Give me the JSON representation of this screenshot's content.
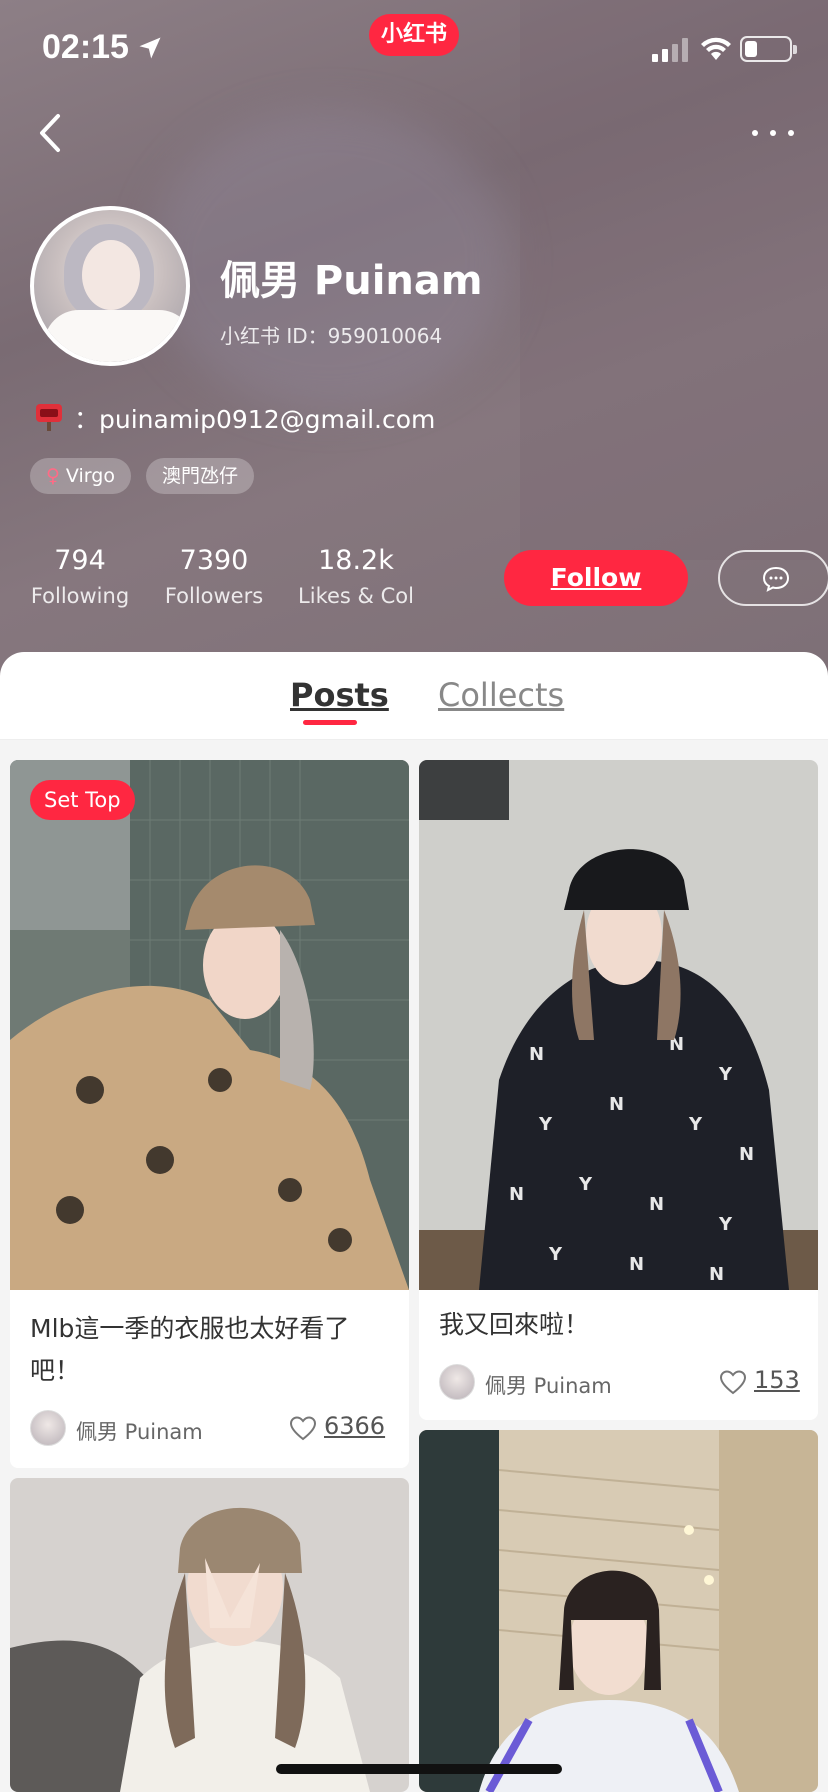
{
  "status_bar": {
    "time": "02:15",
    "brand": "小红书"
  },
  "profile": {
    "name": "佩男 Puinam",
    "id_text": "小红书 ID：959010064",
    "email": "：puinamip0912@gmail.com",
    "tags": [
      {
        "symbol": "♀",
        "label": "Virgo"
      },
      {
        "label": "澳門氹仔"
      }
    ],
    "stats": [
      {
        "value": "794",
        "label": "Following"
      },
      {
        "value": "7390",
        "label": "Followers"
      },
      {
        "value": "18.2k",
        "label": "Likes & Col"
      }
    ],
    "follow_label": "Follow"
  },
  "tabs": [
    {
      "label": "Posts",
      "active": true
    },
    {
      "label": "Collects",
      "active": false
    }
  ],
  "posts": [
    {
      "badge": "Set Top",
      "title": "Mlb這一季的衣服也太好看了吧！",
      "author": "佩男 Puinam",
      "likes": "6366"
    },
    {
      "title": "我又回來啦！",
      "author": "佩男 Puinam",
      "likes": "153"
    }
  ],
  "colors": {
    "accent": "#ff2741",
    "header_bg": "#857880"
  }
}
